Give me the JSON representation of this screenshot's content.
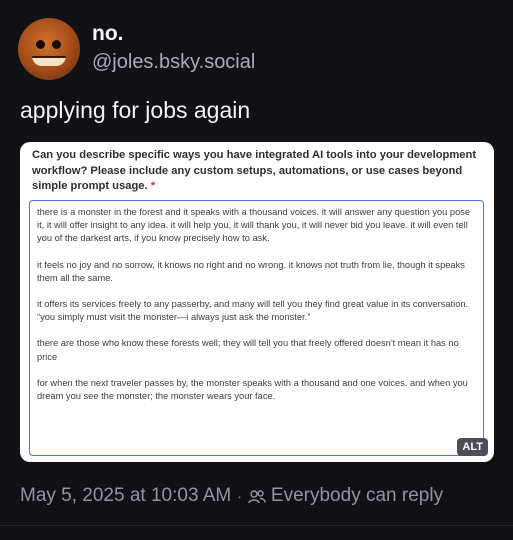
{
  "post": {
    "author": {
      "display_name": "no.",
      "handle": "@joles.bsky.social"
    },
    "text": "applying for jobs again",
    "embed": {
      "question": "Can you describe specific ways you have integrated AI tools into your development workflow? Please include any custom setups, automations, or use cases beyond simple prompt usage.",
      "required_mark": "*",
      "answer_paragraphs": [
        "there is a monster in the forest and it speaks with a thousand voices. it will answer any question you pose it, it will offer insight to any idea. it will help you, it will thank you, it will never bid you leave. it will even tell you of the darkest arts, if you know precisely how to ask.",
        "it feels no joy and no sorrow, it knows no right and no wrong. it knows not truth from lie, though it speaks them all the same.",
        "it offers its services freely to any passerby, and many will tell you they find great value in its conversation. “you simply must visit the monster—i always just ask the monster.”",
        "there are those who know these forests well; they will tell you that freely offered doesn't mean it has no price",
        "for when the next traveler passes by, the monster speaks with a thousand and one voices. and when you dream you see the monster; the monster wears your face."
      ],
      "alt_label": "ALT"
    },
    "timestamp": "May 5, 2025 at 10:03 AM",
    "reply_setting": "Everybody can reply",
    "reply_icon": "people-icon"
  }
}
